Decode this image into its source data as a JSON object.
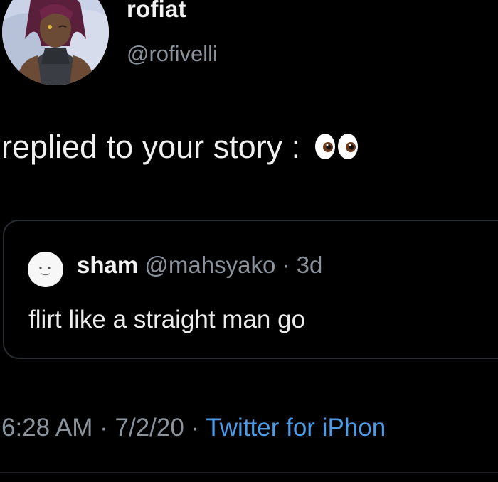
{
  "author": {
    "display_name": "rofiat",
    "handle": "@rofivelli",
    "avatar_icon": "anime-character-avatar"
  },
  "tweet": {
    "text": "replied to your story :",
    "emoji": "eyes-emoji"
  },
  "quoted_tweet": {
    "display_name": "sham",
    "handle": "@mahsyako",
    "separator": " · ",
    "time": "3d",
    "text": "flirt like a straight man go",
    "avatar_icon": "default-face-avatar"
  },
  "meta": {
    "time": "6:28 AM",
    "separator1": " · ",
    "date": "7/2/20",
    "separator2": " · ",
    "source": "Twitter for iPhon"
  },
  "colors": {
    "background": "#000000",
    "primary_text": "#f0f0f0",
    "secondary_text": "#8b949c",
    "link": "#4c9be8",
    "border": "#2a2d31"
  }
}
